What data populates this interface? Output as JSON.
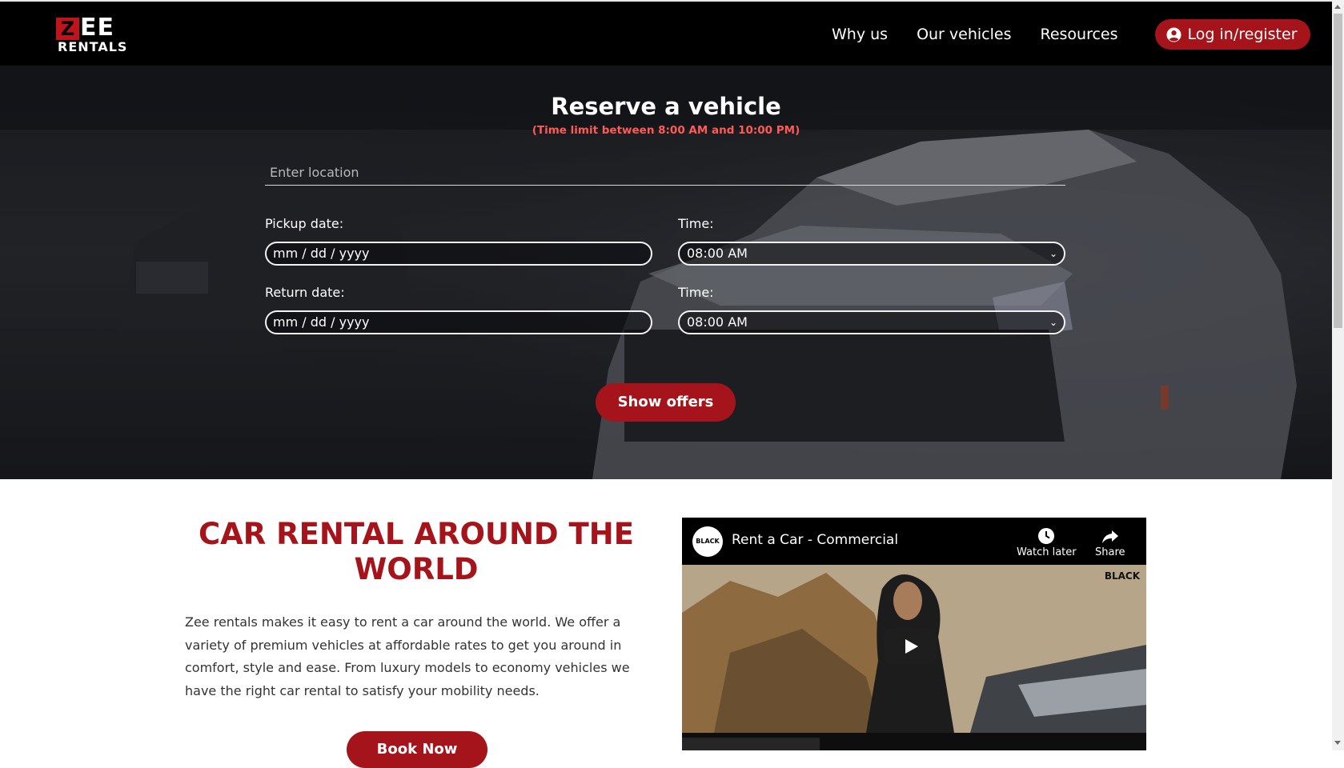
{
  "brand": {
    "mark": "Z",
    "name_top": "EE",
    "name_bottom": "RENTALS",
    "accent_color": "#a6141b"
  },
  "nav": {
    "items": [
      {
        "label": "Why us"
      },
      {
        "label": "Our vehicles"
      },
      {
        "label": "Resources"
      }
    ],
    "login_label": "Log in/register",
    "login_icon": "user-circle-icon"
  },
  "reserve": {
    "title": "Reserve a vehicle",
    "note": "(Time limit between 8:00 AM and 10:00 PM)",
    "location_placeholder": "Enter location",
    "pickup_date_label": "Pickup date:",
    "pickup_date_value": "mm / dd / yyyy",
    "pickup_time_label": "Time:",
    "pickup_time_value": "08:00 AM",
    "return_date_label": "Return date:",
    "return_date_value": "mm / dd / yyyy",
    "return_time_label": "Time:",
    "return_time_value": "08:00 AM",
    "submit_label": "Show offers"
  },
  "about": {
    "title": "CAR RENTAL AROUND THE WORLD",
    "text": "Zee rentals makes it easy to rent a car around the world. We offer a variety of premium vehicles at affordable rates to get you around in comfort, style and ease. From luxury models to economy vehicles we have the right car rental to satisfy your mobility needs.",
    "button_label": "Book Now"
  },
  "video": {
    "channel_badge": "BLACK",
    "title": "Rent a Car - Commercial",
    "watch_later_label": "Watch later",
    "share_label": "Share",
    "overlay_badge": "BLACK"
  }
}
